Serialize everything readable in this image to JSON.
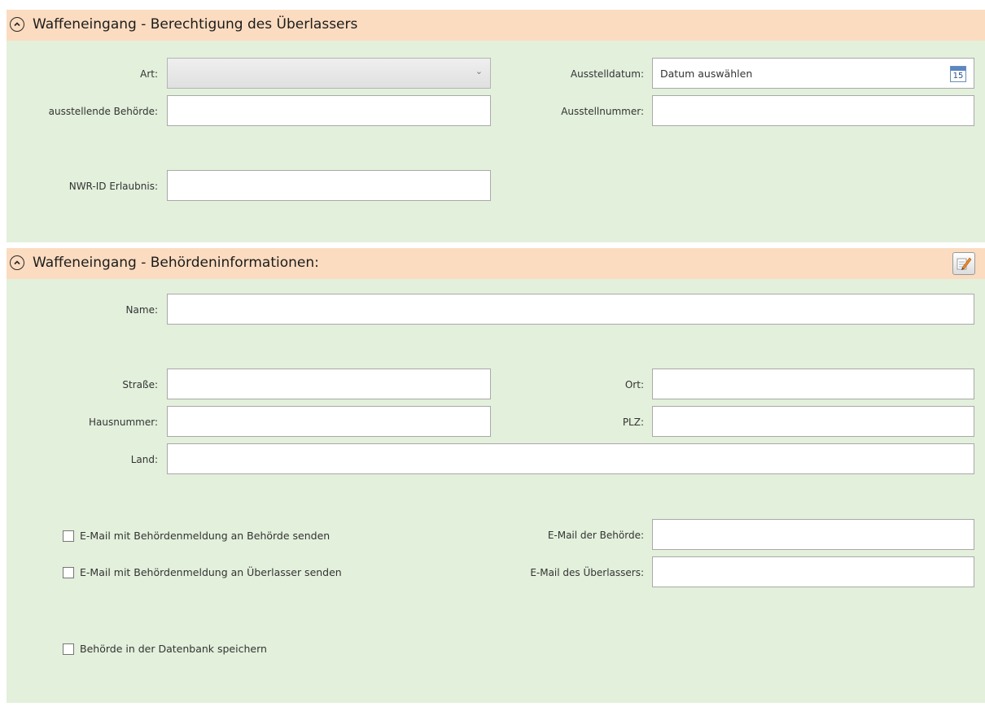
{
  "section1": {
    "title": "Waffeneingang - Berechtigung des Überlassers",
    "art_label": "Art:",
    "art_value": "",
    "ausstelldatum_label": "Ausstelldatum:",
    "ausstelldatum_placeholder": "Datum auswählen",
    "calendar_day": "15",
    "behoerde_label": "ausstellende Behörde:",
    "behoerde_value": "",
    "ausstellnummer_label": "Ausstellnummer:",
    "ausstellnummer_value": "",
    "nwr_label": "NWR-ID Erlaubnis:",
    "nwr_value": ""
  },
  "section2": {
    "title": "Waffeneingang - Behördeninformationen:",
    "name_label": "Name:",
    "name_value": "",
    "strasse_label": "Straße:",
    "strasse_value": "",
    "ort_label": "Ort:",
    "ort_value": "",
    "hausnummer_label": "Hausnummer:",
    "hausnummer_value": "",
    "plz_label": "PLZ:",
    "plz_value": "",
    "land_label": "Land:",
    "land_value": "",
    "chk_email_behoerde": "E-Mail mit Behördenmeldung an Behörde senden",
    "chk_email_ueberlasser": "E-Mail mit Behördenmeldung an Überlasser senden",
    "email_behoerde_label": "E-Mail der Behörde:",
    "email_behoerde_value": "",
    "email_ueberlasser_label": "E-Mail des Überlassers:",
    "email_ueberlasser_value": "",
    "chk_save_db": "Behörde in der Datenbank speichern"
  },
  "colors": {
    "header_bg": "#fbdcc0",
    "body_bg": "#e3f0dc"
  }
}
